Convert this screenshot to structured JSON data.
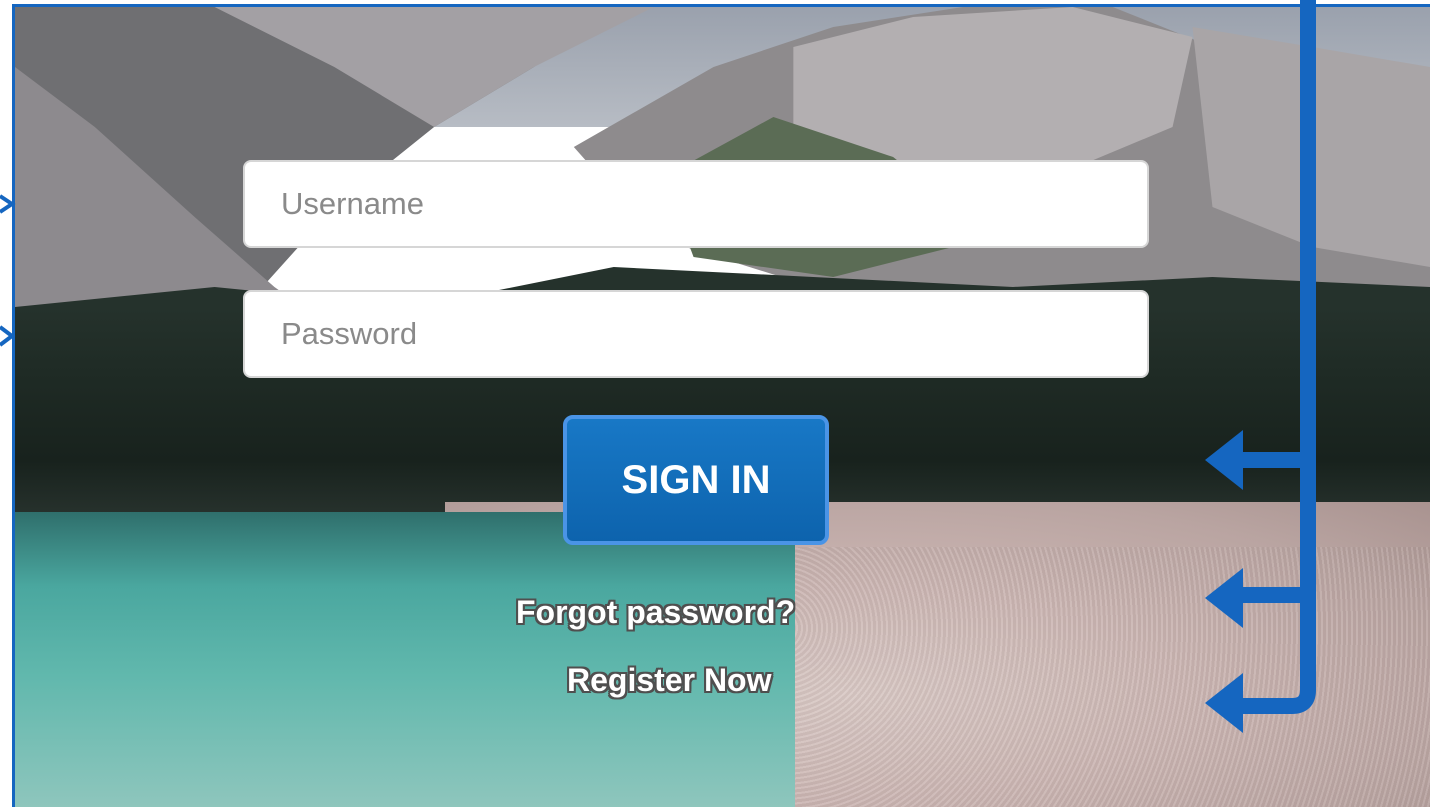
{
  "login": {
    "username_placeholder": "Username",
    "password_placeholder": "Password",
    "signin_label": "SIGN IN",
    "forgot_label": "Forgot password?",
    "register_label": "Register Now"
  },
  "theme": {
    "annotation_color": "#1566c0",
    "button_color": "#1878c6"
  }
}
